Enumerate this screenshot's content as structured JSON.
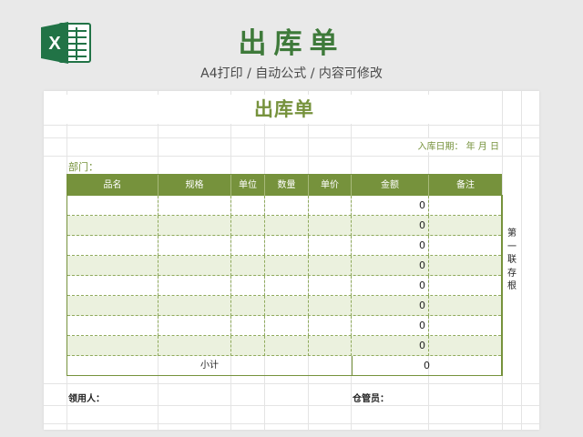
{
  "header": {
    "title": "出库单",
    "subtitle": "A4打印 / 自动公式 / 内容可修改",
    "icon": "excel-icon",
    "icon_letter": "X",
    "accent_color": "#217346"
  },
  "form": {
    "title": "出库单",
    "date_label": "入库日期：    年   月   日",
    "department_label": "部门：",
    "stub_text": [
      "第",
      "一",
      "联",
      "存",
      "根"
    ],
    "theme_color": "#76923c",
    "alt_row_color": "#ebf1de"
  },
  "table": {
    "columns": [
      "品名",
      "规格",
      "单位",
      "数量",
      "单价",
      "金额",
      "备注"
    ],
    "amounts": [
      "0",
      "0",
      "0",
      "0",
      "0",
      "0",
      "0",
      "0"
    ],
    "subtotal_label": "小计",
    "subtotal_value": "0"
  },
  "footer": {
    "receiver_label": "领用人：",
    "keeper_label": "仓管员："
  }
}
